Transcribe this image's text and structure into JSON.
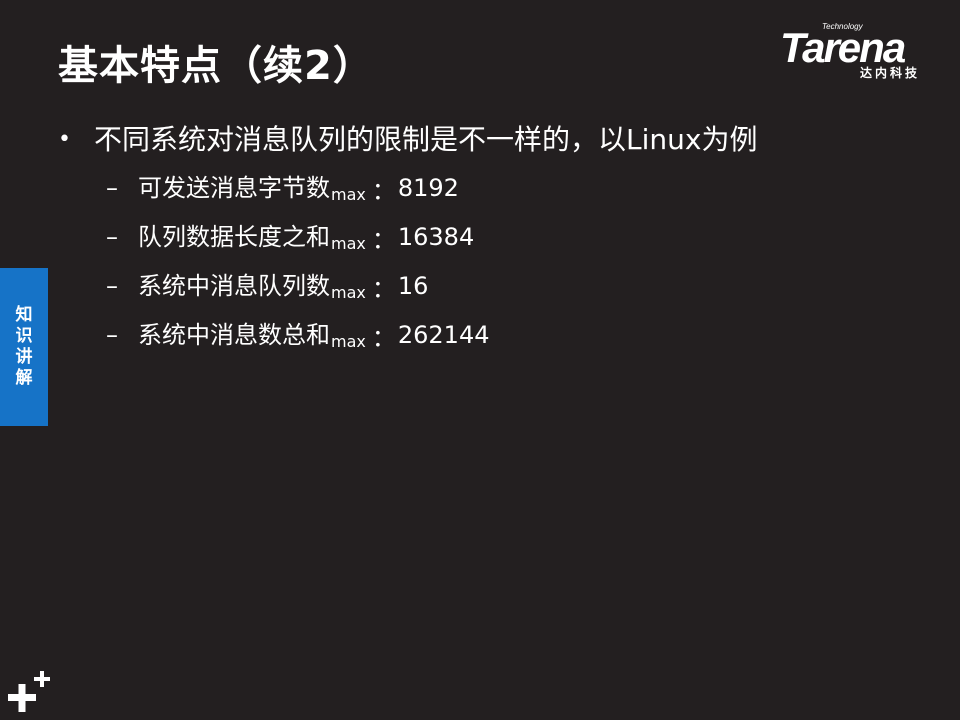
{
  "title": "基本特点（续2）",
  "logo": {
    "tagline": "Technology",
    "wordmark": "Tarena",
    "chinese": "达内科技"
  },
  "bullet": {
    "text": "不同系统对消息队列的限制是不一样的，以Linux为例",
    "items": [
      {
        "label": "可发送消息字节数",
        "suffix": "max",
        "value": "8192"
      },
      {
        "label": "队列数据长度之和",
        "suffix": "max",
        "value": "16384"
      },
      {
        "label": "系统中消息队列数",
        "suffix": "max",
        "value": "16"
      },
      {
        "label": "系统中消息数总和",
        "suffix": "max",
        "value": "262144"
      }
    ]
  },
  "side_tab": {
    "chars": [
      "知",
      "识",
      "讲",
      "解"
    ]
  },
  "colors": {
    "background": "#231f20",
    "side_tab": "#1673c7",
    "text": "#ffffff"
  }
}
